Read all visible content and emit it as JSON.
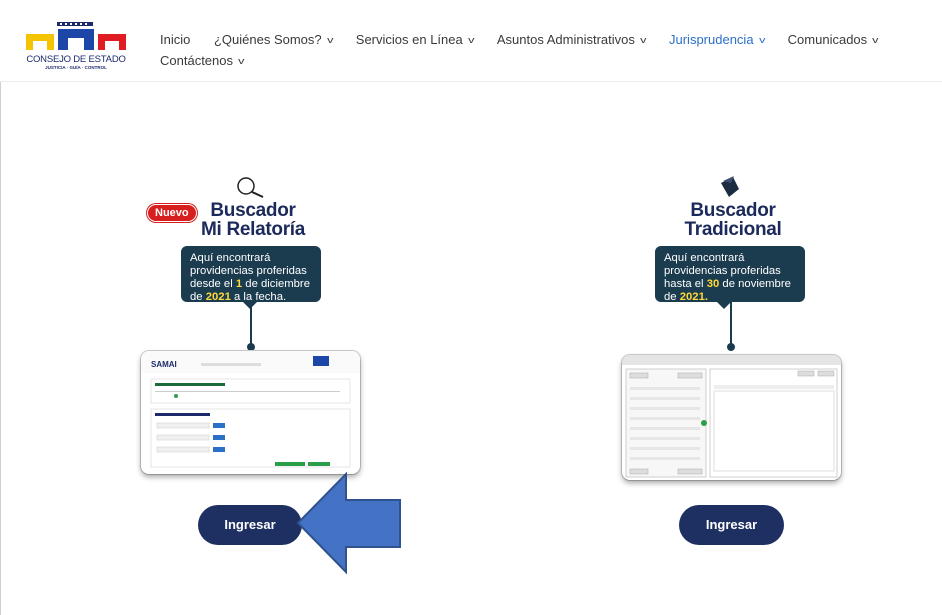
{
  "logo": {
    "name": "CONSEJO DE ESTADO",
    "tagline": "JUSTICIA · GUÍA · CONTROL"
  },
  "nav": [
    {
      "label": "Inicio",
      "has_dropdown": false
    },
    {
      "label": "¿Quiénes Somos?",
      "has_dropdown": true
    },
    {
      "label": "Servicios en Línea",
      "has_dropdown": true
    },
    {
      "label": "Asuntos Administrativos",
      "has_dropdown": true
    },
    {
      "label": "Jurisprudencia",
      "has_dropdown": true,
      "active": true
    },
    {
      "label": "Comunicados",
      "has_dropdown": true
    },
    {
      "label": "Contáctenos",
      "has_dropdown": true
    }
  ],
  "left_card": {
    "badge": "Nuevo",
    "title_line1": "Buscador",
    "title_line2": "Mi Relatoría",
    "desc_1": "Aquí encontrará providencias proferidas desde el ",
    "desc_2": "1",
    "desc_3": " de diciembre de ",
    "desc_4": "2021",
    "desc_5": " a la fecha.",
    "button": "Ingresar",
    "icon": "magnifier-icon"
  },
  "right_card": {
    "title_line1": "Buscador",
    "title_line2": "Tradicional",
    "desc_1": "Aquí encontrará providencias proferidas hasta el ",
    "desc_2": "30",
    "desc_3": " de noviembre de ",
    "desc_4": "2021.",
    "button": "Ingresar",
    "icon": "folder-icon"
  },
  "colors": {
    "navy": "#1e2f62",
    "active_link": "#2b6fc7",
    "badge": "#d81f1f",
    "tooltip": "#1b3b4f",
    "highlight": "#ffd83a",
    "arrow": "#4472c4"
  }
}
